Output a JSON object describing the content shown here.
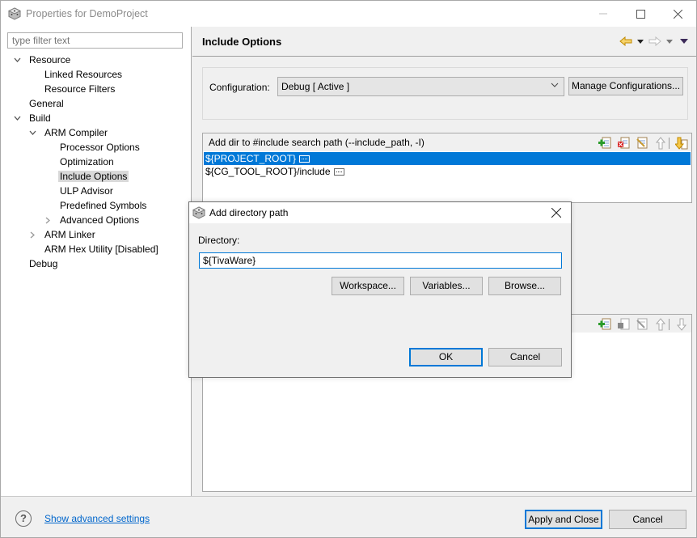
{
  "window": {
    "title": "Properties for DemoProject",
    "controls": {
      "minimize": "minimize",
      "maximize": "maximize",
      "close": "close"
    }
  },
  "sidebar": {
    "filter_placeholder": "type filter text",
    "tree": [
      {
        "label": "Resource",
        "level": 0,
        "expanded": true,
        "has_children": true
      },
      {
        "label": "Linked Resources",
        "level": 1,
        "has_children": false
      },
      {
        "label": "Resource Filters",
        "level": 1,
        "has_children": false
      },
      {
        "label": "General",
        "level": 0,
        "has_children": false
      },
      {
        "label": "Build",
        "level": 0,
        "expanded": true,
        "has_children": true
      },
      {
        "label": "ARM Compiler",
        "level": 1,
        "expanded": true,
        "has_children": true
      },
      {
        "label": "Processor Options",
        "level": 2,
        "has_children": false
      },
      {
        "label": "Optimization",
        "level": 2,
        "has_children": false
      },
      {
        "label": "Include Options",
        "level": 2,
        "has_children": false,
        "selected": true
      },
      {
        "label": "ULP Advisor",
        "level": 2,
        "has_children": false
      },
      {
        "label": "Predefined Symbols",
        "level": 2,
        "has_children": false
      },
      {
        "label": "Advanced Options",
        "level": 2,
        "expanded": false,
        "has_children": true
      },
      {
        "label": "ARM Linker",
        "level": 1,
        "expanded": false,
        "has_children": true
      },
      {
        "label": "ARM Hex Utility  [Disabled]",
        "level": 1,
        "has_children": false
      },
      {
        "label": "Debug",
        "level": 0,
        "has_children": false
      }
    ]
  },
  "page": {
    "title": "Include Options",
    "nav": {
      "back_icon": "back-arrow-icon",
      "forward_icon": "forward-arrow-icon",
      "menu_icon": "view-menu-icon"
    },
    "configuration": {
      "label": "Configuration:",
      "selected": "Debug  [ Active ]",
      "manage_button": "Manage Configurations..."
    },
    "include_paths": {
      "header": "Add dir to #include search path (--include_path, -I)",
      "items": [
        {
          "value": "${PROJECT_ROOT}",
          "selected": true
        },
        {
          "value": "${CG_TOOL_ROOT}/include",
          "selected": false
        }
      ],
      "tools": [
        "add-icon",
        "delete-icon",
        "edit-icon",
        "move-up-icon",
        "move-down-icon"
      ]
    },
    "second_list": {
      "header": "",
      "items": [],
      "tools": [
        "add-icon",
        "delete-icon",
        "edit-icon",
        "move-up-icon",
        "move-down-icon"
      ]
    }
  },
  "footer": {
    "help_icon": "help-icon",
    "advanced_link": "Show advanced settings",
    "apply_close": "Apply and Close",
    "cancel": "Cancel"
  },
  "dialog": {
    "title": "Add directory path",
    "directory_label": "Directory:",
    "directory_value": "${TivaWare}",
    "workspace_button": "Workspace...",
    "variables_button": "Variables...",
    "browse_button": "Browse...",
    "ok_button": "OK",
    "cancel_button": "Cancel"
  },
  "colors": {
    "selection": "#0078d7",
    "link": "#0066cc",
    "tree_selection": "#d9d9d9"
  }
}
